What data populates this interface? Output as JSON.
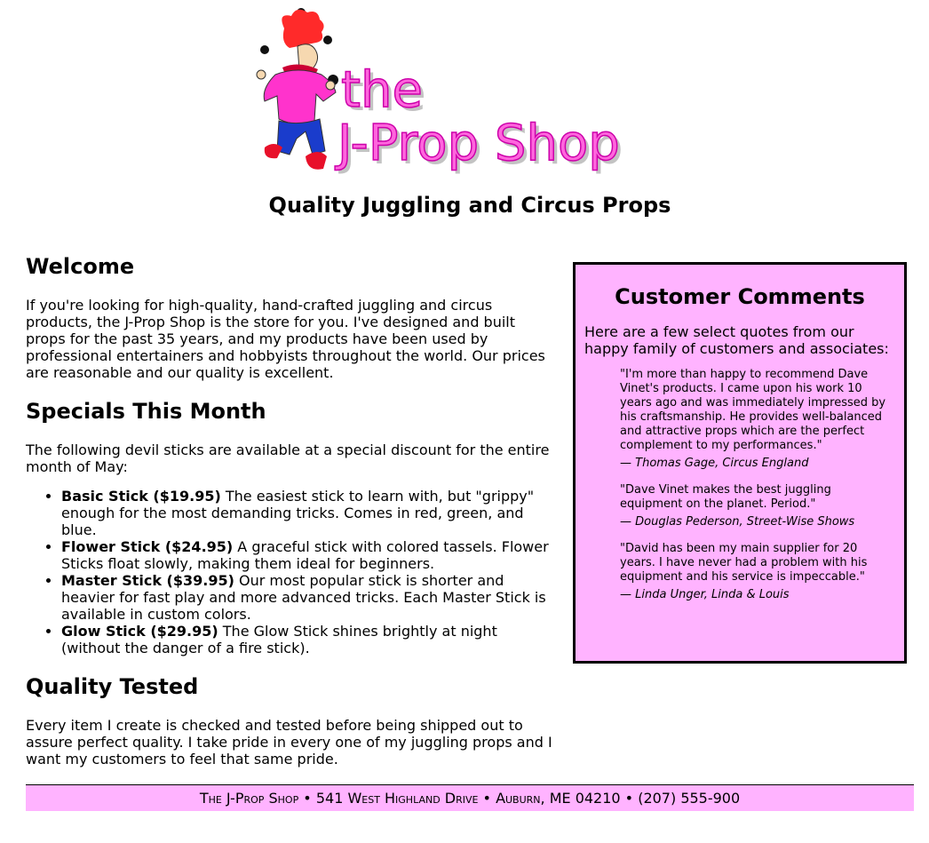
{
  "header": {
    "logo_text_line1": "the",
    "logo_text_line2": "J-Prop Shop",
    "tagline": "Quality Juggling and Circus Props"
  },
  "main": {
    "welcome": {
      "heading": "Welcome",
      "text": "If you're looking for high-quality, hand-crafted juggling and circus products, the J-Prop Shop is the store for you. I've designed and built props for the past 35 years, and my products have been used by professional entertainers and hobbyists throughout the world. Our prices are reasonable and our quality is excellent."
    },
    "specials": {
      "heading": "Specials This Month",
      "intro": "The following devil sticks are available at a special discount for the entire month of May:",
      "items": [
        {
          "name": "Basic Stick ($19.95)",
          "description": " The easiest stick to learn with, but \"grippy\" enough for the most demanding tricks. Comes in red, green, and blue."
        },
        {
          "name": "Flower Stick ($24.95)",
          "description": " A graceful stick with colored tassels. Flower Sticks float slowly, making them ideal for beginners."
        },
        {
          "name": "Master Stick ($39.95)",
          "description": " Our most popular stick is shorter and heavier for fast play and more advanced tricks. Each Master Stick is available in custom colors."
        },
        {
          "name": "Glow Stick ($29.95)",
          "description": " The Glow Stick shines brightly at night (without the danger of a fire stick)."
        }
      ]
    },
    "quality": {
      "heading": "Quality Tested",
      "text": "Every item I create is checked and tested before being shipped out to assure perfect quality. I take pride in every one of my juggling props and I want my customers to feel that same pride."
    }
  },
  "comments": {
    "heading": "Customer Comments",
    "intro": "Here are a few select quotes from our happy family of customers and associates:",
    "quotes": [
      {
        "text": "\"I'm more than happy to recommend Dave Vinet's products. I came upon his work 10 years ago and was immediately impressed by his craftsmanship. He provides well-balanced and attractive props which are the perfect complement to my performances.\"",
        "attribution": "— Thomas Gage, Circus England"
      },
      {
        "text": "\"Dave Vinet makes the best juggling equipment on the planet. Period.\"",
        "attribution": "— Douglas Pederson, Street-Wise Shows"
      },
      {
        "text": "\"David has been my main supplier for 20 years. I have never had a problem with his equipment and his service is impeccable.\"",
        "attribution": "— Linda Unger, Linda & Louis"
      }
    ]
  },
  "footer": {
    "text": "The J-Prop Shop • 541 West Highland Drive • Auburn, ME 04210 • (207) 555-900"
  },
  "colors": {
    "accent_pink": "#ffb3ff",
    "logo_magenta": "#ff33cc",
    "border": "#000000"
  }
}
